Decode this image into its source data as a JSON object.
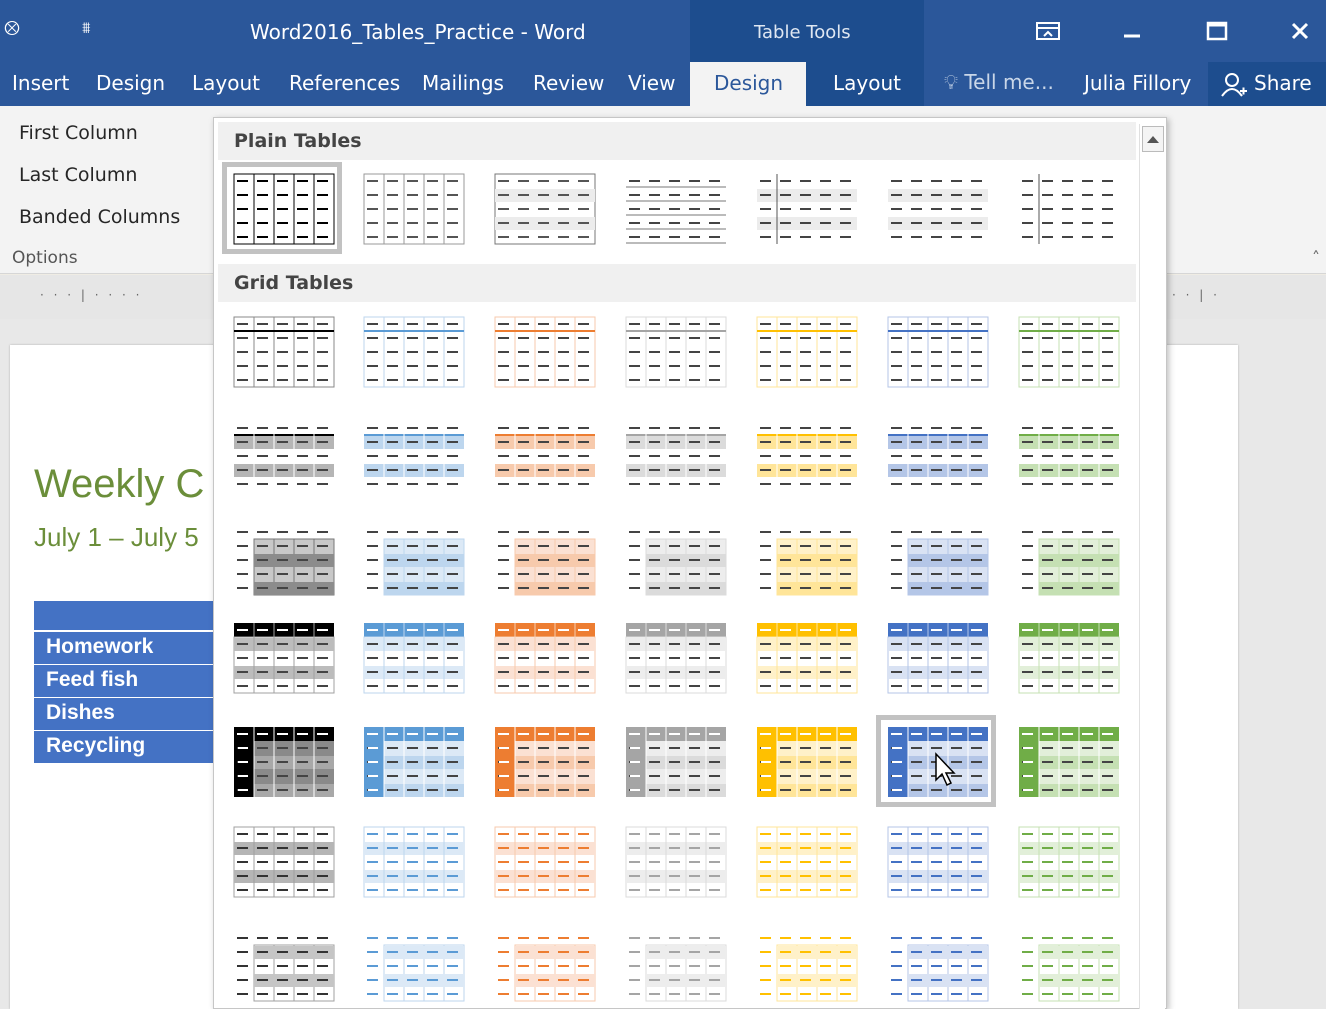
{
  "titlebar": {
    "qat_icon": "save-icon",
    "customize_icon": "customize-qat-icon",
    "title": "Word2016_Tables_Practice - Word",
    "context_title": "Table Tools",
    "controls": [
      "ribbon-display-options-icon",
      "minimize-icon",
      "maximize-icon",
      "close-icon"
    ]
  },
  "tabs": {
    "insert": "Insert",
    "design": "Design",
    "layout": "Layout",
    "references": "References",
    "mailings": "Mailings",
    "review": "Review",
    "view": "View",
    "table_design": "Design",
    "table_layout": "Layout",
    "tell_me": "Tell me...",
    "user": "Julia Fillory",
    "share": "Share"
  },
  "ribbon": {
    "options": [
      "First Column",
      "Last Column",
      "Banded Columns"
    ],
    "group_label": "Options"
  },
  "document": {
    "title": "Weekly C",
    "subtitle": "July 1 – July 5",
    "table_rows": [
      "Homework",
      "Feed fish",
      "Dishes",
      "Recycling"
    ],
    "table_color": "#4472c4",
    "heading_color": "#6b8e3a"
  },
  "gallery": {
    "sections": [
      "Plain Tables",
      "Grid Tables"
    ],
    "selected_style": "Grid Table 5 Dark - Accent 5",
    "accent_colors": {
      "black": "#000000",
      "blue": "#5b9bd5",
      "orange": "#ed7d31",
      "gray": "#a5a5a5",
      "gold": "#ffc000",
      "darkblue": "#4472c4",
      "green": "#70ad47"
    }
  }
}
